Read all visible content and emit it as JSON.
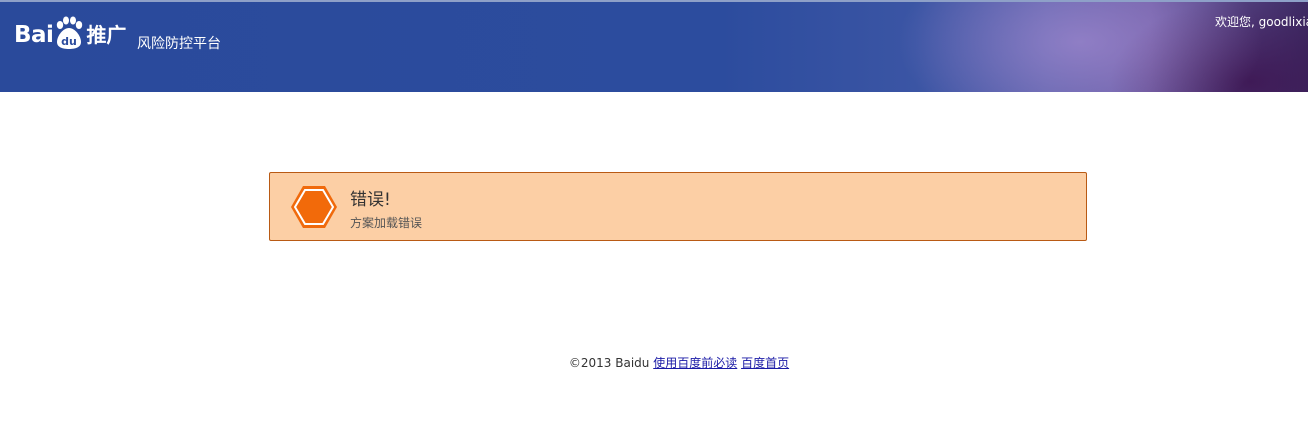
{
  "header": {
    "logo_bai": "Bai",
    "logo_du": "du",
    "logo_tuiguang": "推广",
    "platform_name": "风险防控平台",
    "welcome": "欢迎您, goodlixia"
  },
  "alert": {
    "title": "错误!",
    "message": "方案加载错误",
    "icon": "error-hexagon-icon",
    "colors": {
      "background": "#fccfa5",
      "border": "#b95a14",
      "icon": "#f06a0c"
    }
  },
  "footer": {
    "copyright": "©2013 Baidu",
    "link_usage": "使用百度前必读",
    "link_home": "百度首页"
  },
  "colors": {
    "header_blue": "#2c4c9e",
    "link": "#1a1aa6"
  }
}
